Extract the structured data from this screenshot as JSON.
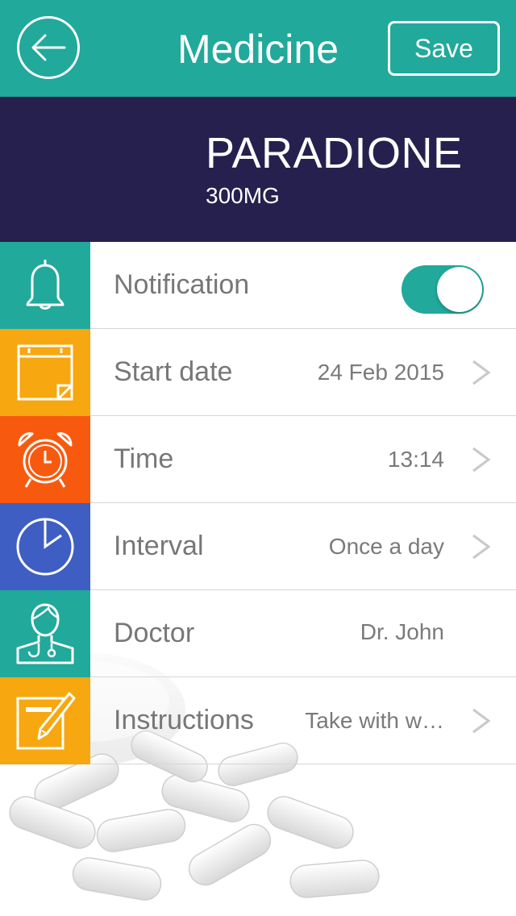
{
  "header": {
    "title": "Medicine",
    "save_label": "Save",
    "back_icon": "arrow-left-icon",
    "color": "#21a99b"
  },
  "medicine": {
    "name": "PARADIONE",
    "dose": "300MG",
    "banner_color": "#25204e"
  },
  "rows": [
    {
      "id": "notification",
      "label": "Notification",
      "icon": "bell-icon",
      "color": "#21a99b",
      "toggle_on": true
    },
    {
      "id": "start-date",
      "label": "Start date",
      "value": "24 Feb 2015",
      "icon": "calendar-icon",
      "color": "#f7a70f"
    },
    {
      "id": "time",
      "label": "Time",
      "value": "13:14",
      "icon": "alarm-clock-icon",
      "color": "#f75a0e"
    },
    {
      "id": "interval",
      "label": "Interval",
      "value": "Once a day",
      "icon": "pie-clock-icon",
      "color": "#3f5ec3"
    },
    {
      "id": "doctor",
      "label": "Doctor",
      "value": "Dr. John",
      "icon": "doctor-icon",
      "color": "#21a99b"
    },
    {
      "id": "instructions",
      "label": "Instructions",
      "value": "Take with w…",
      "icon": "note-pencil-icon",
      "color": "#f7a70f"
    }
  ]
}
